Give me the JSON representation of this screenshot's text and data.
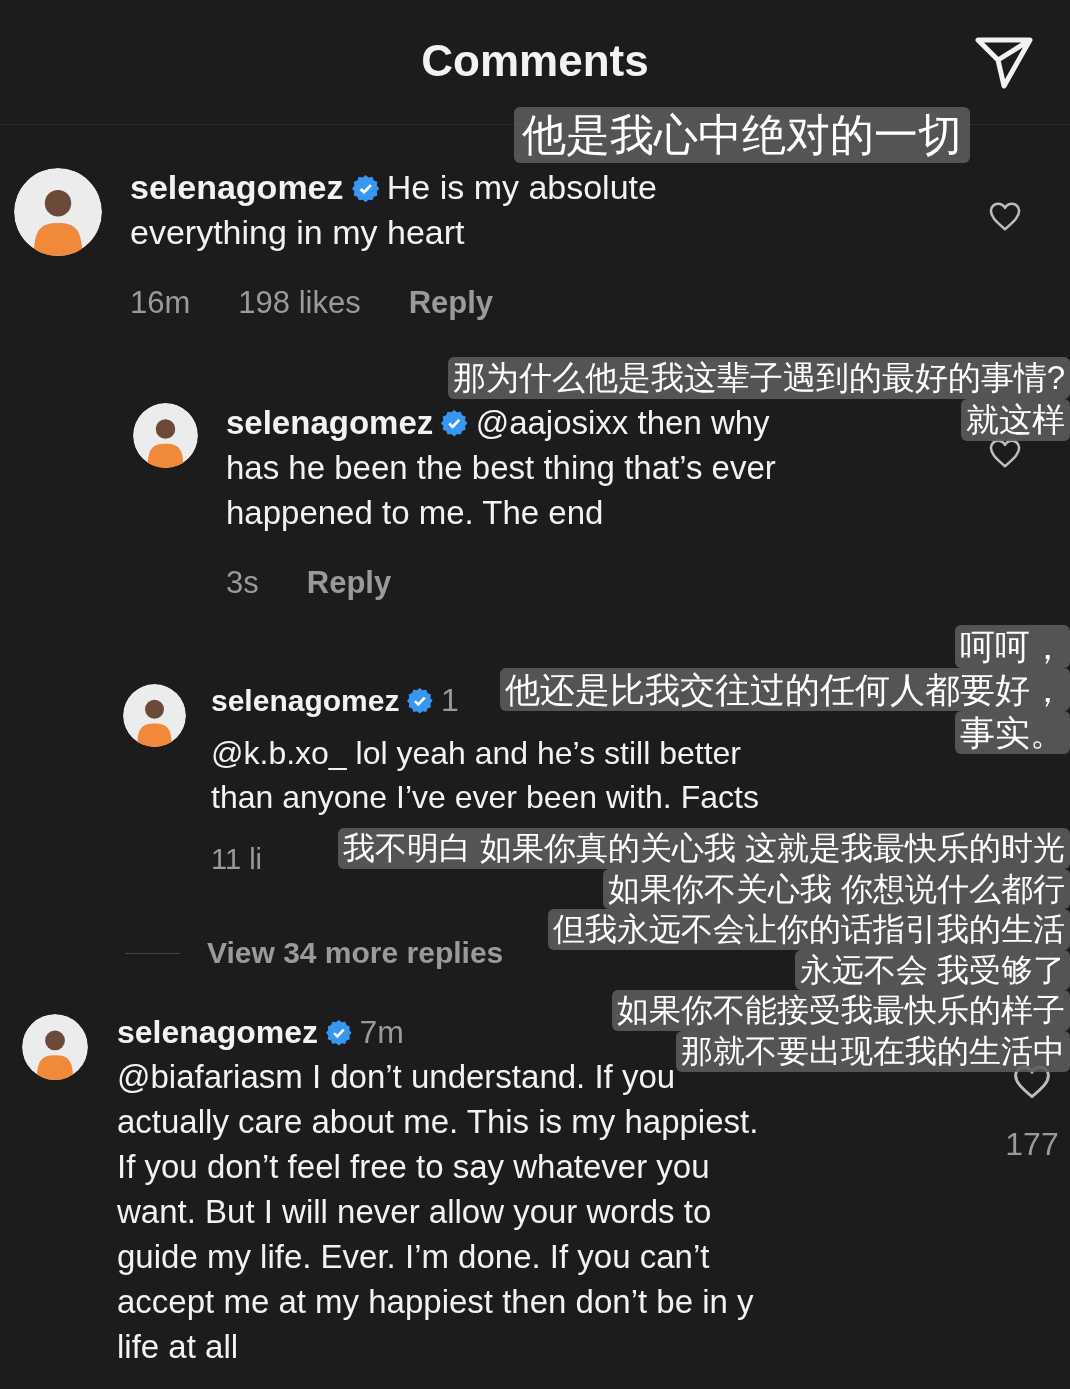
{
  "header": {
    "title": "Comments"
  },
  "comments": [
    {
      "username": "selenagomez",
      "verified": true,
      "text": "He is my absolute\neverything in my heart",
      "heart_visible": true,
      "meta": [
        {
          "kind": "info",
          "text": "16m"
        },
        {
          "kind": "info",
          "text": "198 likes"
        },
        {
          "kind": "reply",
          "text": "Reply"
        }
      ]
    },
    {
      "username": "selenagomez",
      "verified": true,
      "text": "@aajosixx then why\nhas he been the best thing that’s ever\nhappened to me. The end",
      "heart_visible": true,
      "meta": [
        {
          "kind": "info",
          "text": "3s"
        },
        {
          "kind": "reply",
          "text": "Reply"
        }
      ]
    },
    {
      "username": "selenagomez",
      "verified": true,
      "time": "1",
      "text": "@k.b.xo_ lol yeah and he’s still better\nthan anyone I’ve ever been with. Facts",
      "meta": [
        {
          "kind": "info",
          "text": "11 li"
        }
      ]
    },
    {
      "username": "selenagomez",
      "verified": true,
      "time": "7m",
      "text": "@biafariasm I don’t understand. If you\nactually care about me. This is my happiest.\nIf you don’t feel free to say whatever you\nwant. But I will never allow your words to\nguide my life. Ever. I’m done. If you can’t\naccept me at my happiest then don’t be in y\nlife at all",
      "heart_visible": true,
      "like_count": "177"
    }
  ],
  "more_replies": "View 34 more replies",
  "subtitles": [
    {
      "lines": [
        "他是我心中绝对的一切"
      ]
    },
    {
      "lines": [
        "那为什么他是我这辈子遇到的最好的事情?",
        "就这样"
      ]
    },
    {
      "lines": [
        "呵呵，",
        "他还是比我交往过的任何人都要好，",
        "事实。"
      ]
    },
    {
      "lines": [
        "我不明白 如果你真的关心我 这就是我最快乐的时光",
        "如果你不关心我 你想说什么都行",
        "但我永远不会让你的话指引我的生活",
        "永远不会 我受够了",
        "如果你不能接受我最快乐的样子",
        "那就不要出现在我的生活中"
      ]
    }
  ]
}
